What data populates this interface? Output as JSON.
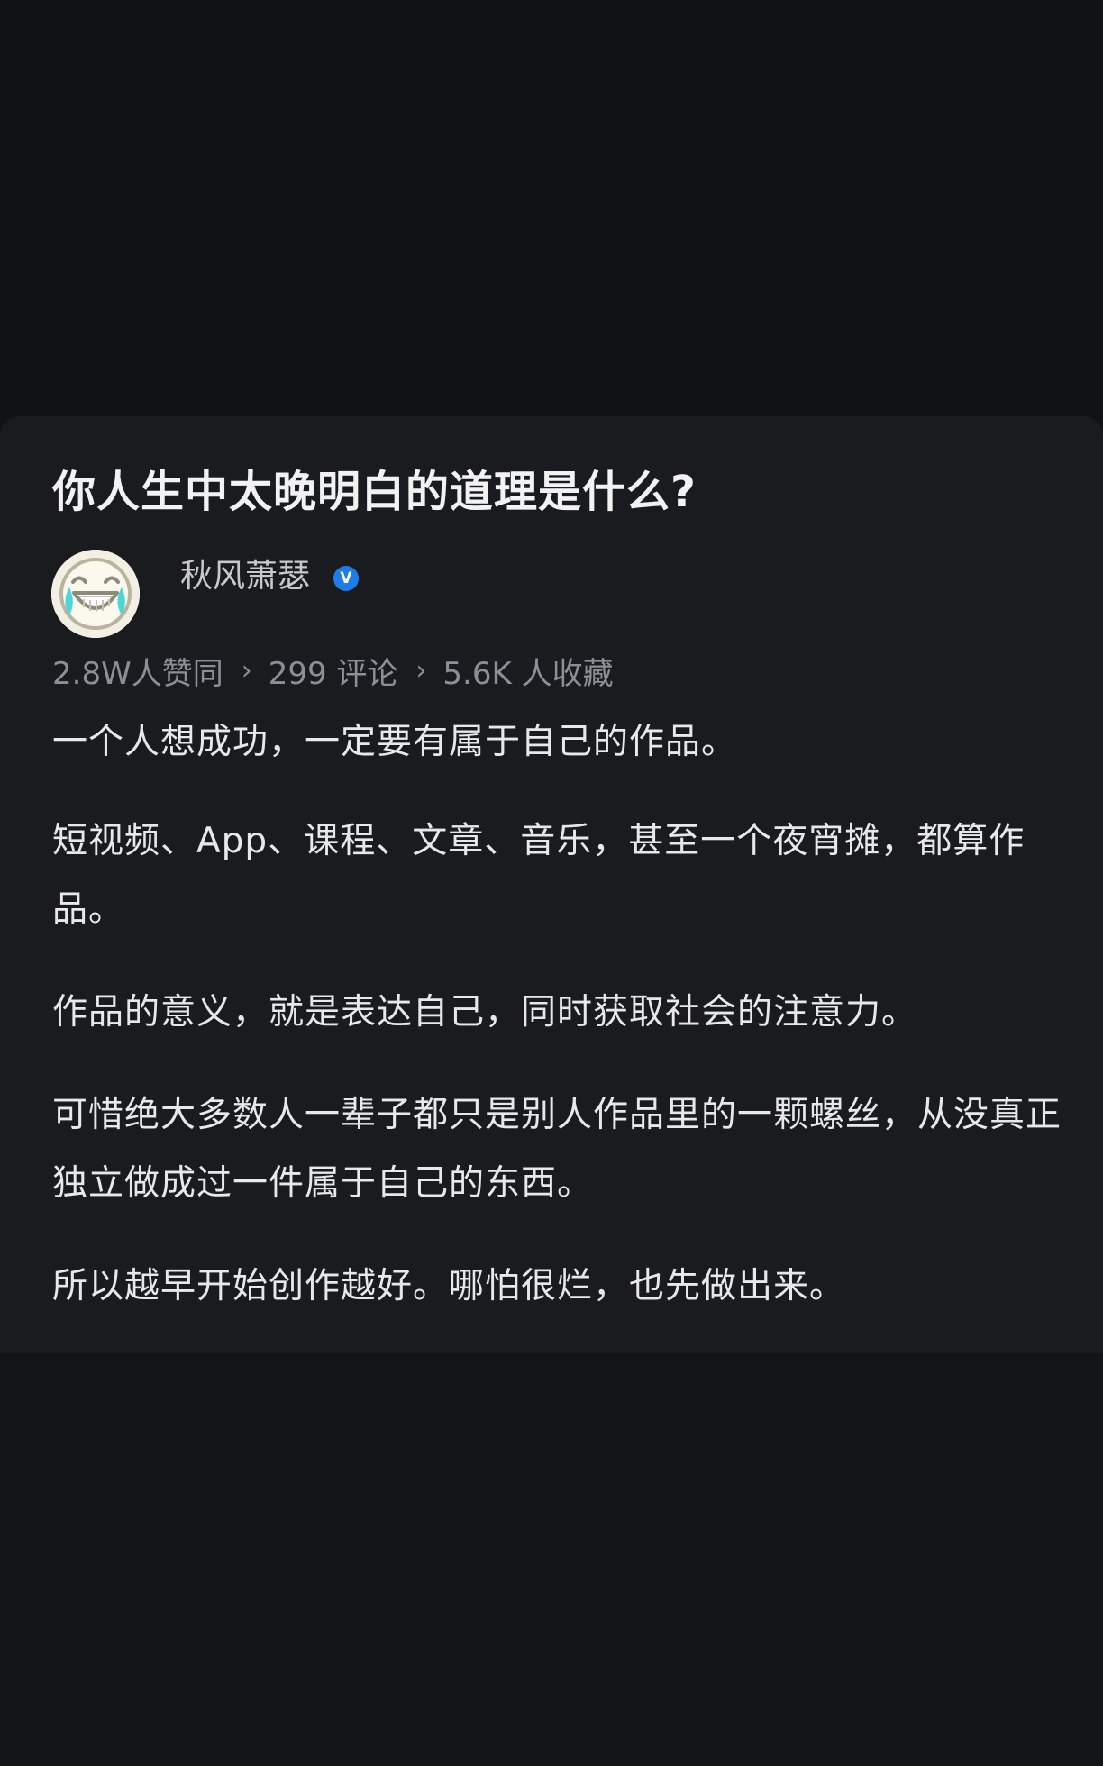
{
  "question": {
    "title": "你人生中太晚明白的道理是什么?"
  },
  "author": {
    "name": "秋风萧瑟",
    "verified_badge": "V",
    "avatar_icon": "laughing-crying-emoji"
  },
  "stats": {
    "likes": "2.8W人赞同",
    "comments": "299 评论",
    "favorites": "5.6K 人收藏",
    "separator": "›"
  },
  "answer": {
    "paragraphs": [
      "一个人想成功，一定要有属于自己的作品。",
      "短视频、App、课程、文章、音乐，甚至一个夜宵摊，都算作品。",
      "作品的意义，就是表达自己，同时获取社会的注意力。",
      "可惜绝大多数人一辈子都只是别人作品里的一颗螺丝，从没真正独立做成过一件属于自己的东西。",
      "所以越早开始创作越好。哪怕很烂，也先做出来。"
    ]
  },
  "colors": {
    "background": "#111215",
    "card": "#1a1b1f",
    "text": "#e8e8eb",
    "muted": "#8e8f95",
    "verified": "#1e7ce8"
  }
}
